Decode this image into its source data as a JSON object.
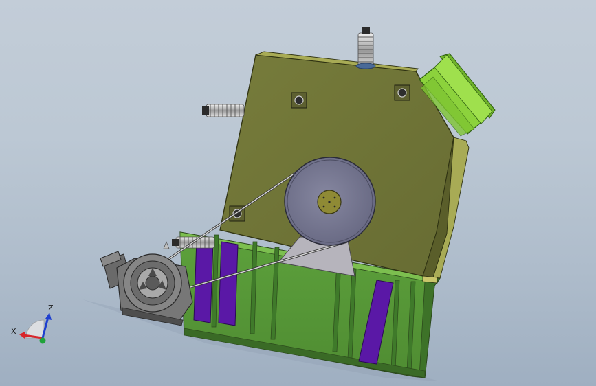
{
  "triad": {
    "x_label": "X",
    "z_label": "Z",
    "x_color": "#d8262b",
    "y_color": "#1fa33a",
    "z_color": "#1e3fcf"
  },
  "colors": {
    "background_top": "#c3cdd8",
    "background_bottom": "#9fafc1",
    "housing_olive": "#6f7437",
    "housing_top": "#a8ab55",
    "base_green": "#5a9a3a",
    "panel_purple": "#5a18a6",
    "hopper_green": "#8cd23c",
    "rotor_gray": "#7a7b93",
    "motor_gray": "#6c6c6c"
  }
}
